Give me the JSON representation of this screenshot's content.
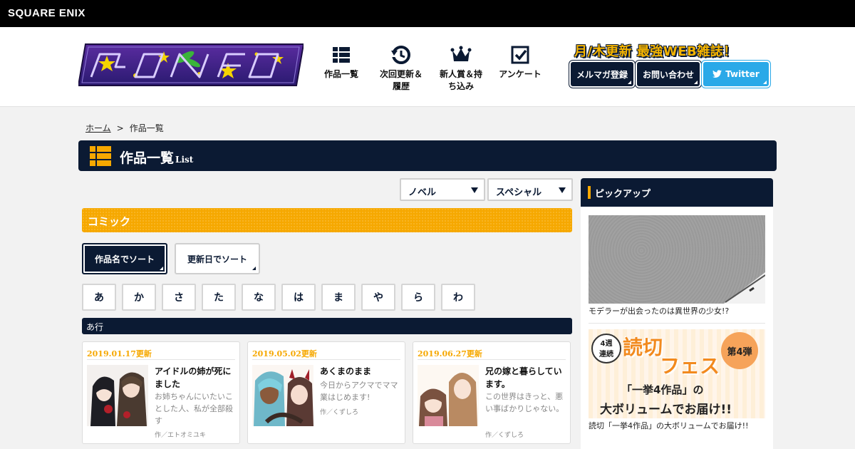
{
  "brand": "SQUARE ENIX",
  "header": {
    "nav": [
      {
        "label": "作品一覧",
        "icon": "list-icon"
      },
      {
        "label": "次回更新＆履歴",
        "icon": "refresh-clock-icon"
      },
      {
        "label": "新人賞＆持ち込み",
        "icon": "crown-icon"
      },
      {
        "label": "アンケート",
        "icon": "checkbox-icon"
      }
    ],
    "tagline": "月/木更新 最強WEB雑誌！",
    "buttons": {
      "mailmag": "メルマガ登録",
      "contact": "お問い合わせ",
      "twitter": "Twitter"
    }
  },
  "breadcrumb": {
    "home": "ホーム",
    "separator": ">",
    "current": "作品一覧"
  },
  "page": {
    "title": "作品一覧",
    "subtitle": "List"
  },
  "filters": {
    "novel": "ノベル",
    "special": "スペシャル"
  },
  "section": {
    "title": "コミック"
  },
  "sort": {
    "by_name": "作品名でソート",
    "by_date": "更新日でソート"
  },
  "kana": [
    "あ",
    "か",
    "さ",
    "た",
    "な",
    "は",
    "ま",
    "や",
    "ら",
    "わ"
  ],
  "row_label": "あ行",
  "works": [
    {
      "date": "2019.01.17更新",
      "title": "アイドルの姉が死にました",
      "desc": "お姉ちゃんにいたいことした人、私が全部殺す",
      "author": "作／エトオミユキ"
    },
    {
      "date": "2019.05.02更新",
      "title": "あくまのまま",
      "desc": "今日からアクマでママ業はじめます!",
      "author": "作／くずしろ"
    },
    {
      "date": "2019.06.27更新",
      "title": "兄の嫁と暮らしています。",
      "desc": "この世界はきっと、悪い事ばかりじゃない。",
      "author": "作／くずしろ"
    }
  ],
  "sidebar": {
    "title": "ピックアップ",
    "items": [
      {
        "caption": "モデラーが出会ったのは異世界の少女!?"
      },
      {
        "caption": "読切「一挙4作品」の大ボリュームでお届け!!"
      }
    ],
    "fest": {
      "badge_line1": "4週",
      "badge_line2": "連続",
      "title1": "読切",
      "title2": "フェス",
      "round": "第4弾",
      "banner": "「一挙4作品」の",
      "banner2": "大ボリュームでお届け!!"
    }
  },
  "colors": {
    "navy": "#0b1a33",
    "orange": "#f6a800",
    "twitter": "#2aa9e8"
  }
}
